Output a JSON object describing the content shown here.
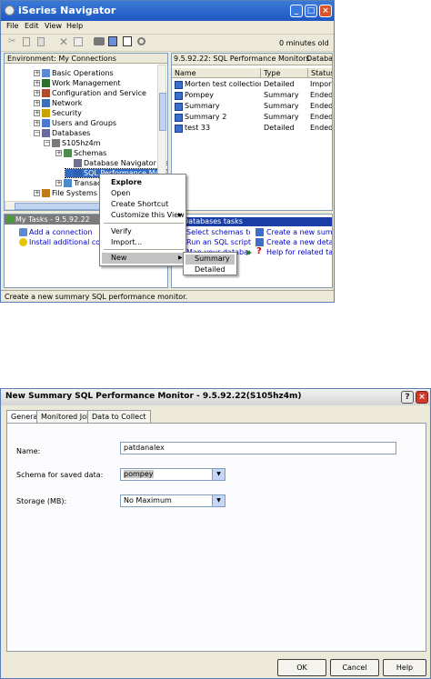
{
  "nav": {
    "title": "iSeries Navigator",
    "menu": [
      "File",
      "Edit",
      "View",
      "Help"
    ],
    "age_text": "0 minutes old",
    "env_label": "Environment: My Connections",
    "right_header": "9.5.92.22:  SQL Performance Monitors",
    "right_header_extra": "Database",
    "columns": [
      "Name",
      "Type",
      "Status"
    ],
    "tree": [
      {
        "label": "Basic Operations",
        "icon": "basic-operations-icon"
      },
      {
        "label": "Work Management",
        "icon": "work-management-icon"
      },
      {
        "label": "Configuration and Service",
        "icon": "configuration-icon"
      },
      {
        "label": "Network",
        "icon": "network-icon"
      },
      {
        "label": "Security",
        "icon": "security-icon"
      },
      {
        "label": "Users and Groups",
        "icon": "users-groups-icon"
      },
      {
        "label": "Databases",
        "icon": "databases-icon"
      },
      {
        "label": "S105hz4m",
        "icon": "database-icon"
      },
      {
        "label": "Schemas",
        "icon": "schemas-icon"
      },
      {
        "label": "Database Navigator Maps",
        "icon": "navigator-maps-icon"
      },
      {
        "label": "SQL Performance Monitors",
        "icon": "sql-monitor-icon"
      },
      {
        "label": "Transactions",
        "icon": "transactions-icon"
      },
      {
        "label": "File Systems",
        "icon": "file-systems-icon"
      }
    ],
    "monitors": [
      {
        "name": "Morten test collection",
        "type": "Detailed",
        "status": "Imported"
      },
      {
        "name": "Pompey",
        "type": "Summary",
        "status": "Ended"
      },
      {
        "name": "Summary",
        "type": "Summary",
        "status": "Ended"
      },
      {
        "name": "Summary 2",
        "type": "Summary",
        "status": "Ended"
      },
      {
        "name": "test 33",
        "type": "Detailed",
        "status": "Ended"
      }
    ],
    "tasks_header": "My Tasks - 9.5.92.22",
    "tasks": [
      "Add a connection",
      "Install additional components"
    ],
    "db_tasks_header": "Databases tasks",
    "db_tasks_col1": [
      "Select schemas to display",
      "Run an SQL script",
      "Map your database"
    ],
    "db_tasks_col2": [
      "Create a new summary",
      "Create a new detailed",
      "Help for related tasks"
    ],
    "status": "Create a new summary SQL performance monitor.",
    "context_menu": [
      "Explore",
      "Open",
      "Create Shortcut",
      "Customize this View",
      "Verify",
      "Import...",
      "New"
    ],
    "submenu": [
      "Summary",
      "Detailed"
    ]
  },
  "dialog": {
    "title": "New Summary SQL Performance Monitor - 9.5.92.22(S105hz4m)",
    "tabs": [
      "General",
      "Monitored Jobs",
      "Data to Collect"
    ],
    "name_label": "Name:",
    "name_value": "patdanalex",
    "schema_label": "Schema for saved data:",
    "schema_value": "pompey",
    "storage_label": "Storage (MB):",
    "storage_value": "No Maximum",
    "ok": "OK",
    "cancel": "Cancel",
    "help": "Help"
  },
  "colors": {
    "title_blue": "#1f57c3",
    "selection": "#316ac5",
    "link": "#0000cc"
  }
}
